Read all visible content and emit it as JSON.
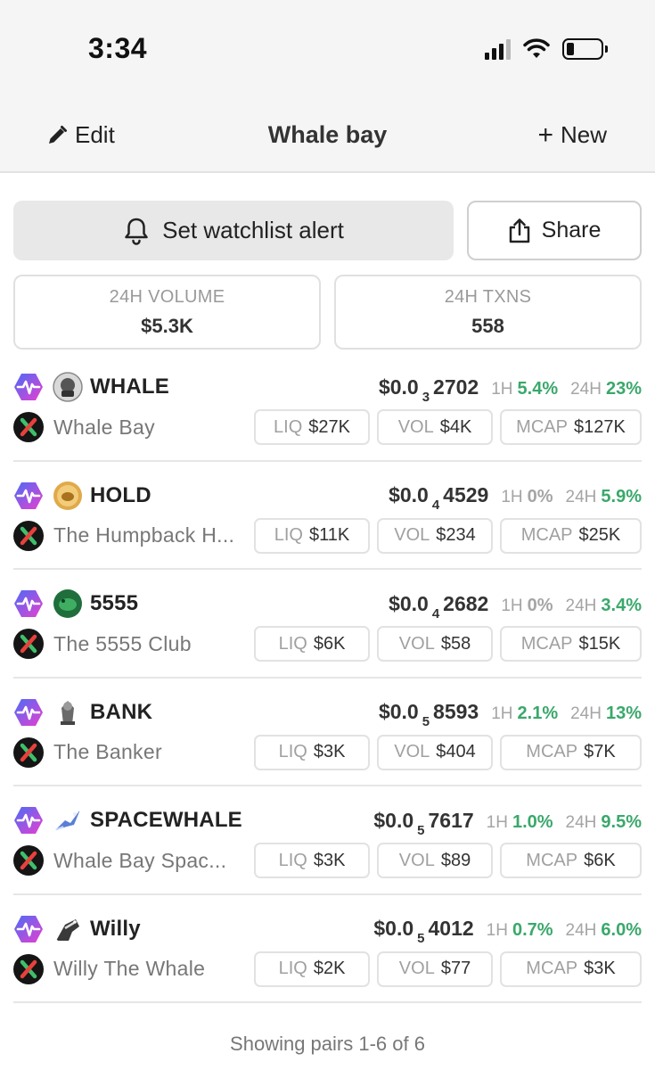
{
  "status_bar": {
    "time": "3:34"
  },
  "nav": {
    "edit_label": "Edit",
    "title": "Whale bay",
    "new_label": "New"
  },
  "actions": {
    "alert_label": "Set watchlist alert",
    "share_label": "Share"
  },
  "stats": {
    "volume_label": "24H VOLUME",
    "volume_value": "$5.3K",
    "txns_label": "24H TXNS",
    "txns_value": "558"
  },
  "labels": {
    "h1": "1H",
    "h24": "24H",
    "liq": "LIQ",
    "vol": "VOL",
    "mcap": "MCAP"
  },
  "pairs": [
    {
      "symbol": "WHALE",
      "name": "Whale Bay",
      "price_prefix": "$0.0",
      "price_zeros": "3",
      "price_digits": "2702",
      "h1": "5.4%",
      "h24": "23%",
      "liq": "$27K",
      "vol": "$4K",
      "mcap": "$127K",
      "avatar_icon": "whale-token-icon"
    },
    {
      "symbol": "HOLD",
      "name": "The Humpback H...",
      "price_prefix": "$0.0",
      "price_zeros": "4",
      "price_digits": "4529",
      "h1": "0%",
      "h24": "5.9%",
      "liq": "$11K",
      "vol": "$234",
      "mcap": "$25K",
      "avatar_icon": "hold-token-icon"
    },
    {
      "symbol": "5555",
      "name": "The 5555 Club",
      "price_prefix": "$0.0",
      "price_zeros": "4",
      "price_digits": "2682",
      "h1": "0%",
      "h24": "3.4%",
      "liq": "$6K",
      "vol": "$58",
      "mcap": "$15K",
      "avatar_icon": "5555-token-icon"
    },
    {
      "symbol": "BANK",
      "name": "The Banker",
      "price_prefix": "$0.0",
      "price_zeros": "5",
      "price_digits": "8593",
      "h1": "2.1%",
      "h24": "13%",
      "liq": "$3K",
      "vol": "$404",
      "mcap": "$7K",
      "avatar_icon": "bank-token-icon"
    },
    {
      "symbol": "SPACEWHALE",
      "name": "Whale Bay Spac...",
      "price_prefix": "$0.0",
      "price_zeros": "5",
      "price_digits": "7617",
      "h1": "1.0%",
      "h24": "9.5%",
      "liq": "$3K",
      "vol": "$89",
      "mcap": "$6K",
      "avatar_icon": "spacewhale-token-icon"
    },
    {
      "symbol": "Willy",
      "name": "Willy The Whale",
      "price_prefix": "$0.0",
      "price_zeros": "5",
      "price_digits": "4012",
      "h1": "0.7%",
      "h24": "6.0%",
      "liq": "$2K",
      "vol": "$77",
      "mcap": "$3K",
      "avatar_icon": "willy-token-icon"
    }
  ],
  "footer": {
    "text": "Showing pairs 1-6 of 6"
  },
  "colors": {
    "positive": "#3aa86b",
    "muted": "#a5a5a5",
    "chain_gradient_start": "#4a6cf7",
    "chain_gradient_end": "#e83fd0",
    "dex_accent": "#e8413c",
    "dex_accent_2": "#3fbf6a"
  }
}
